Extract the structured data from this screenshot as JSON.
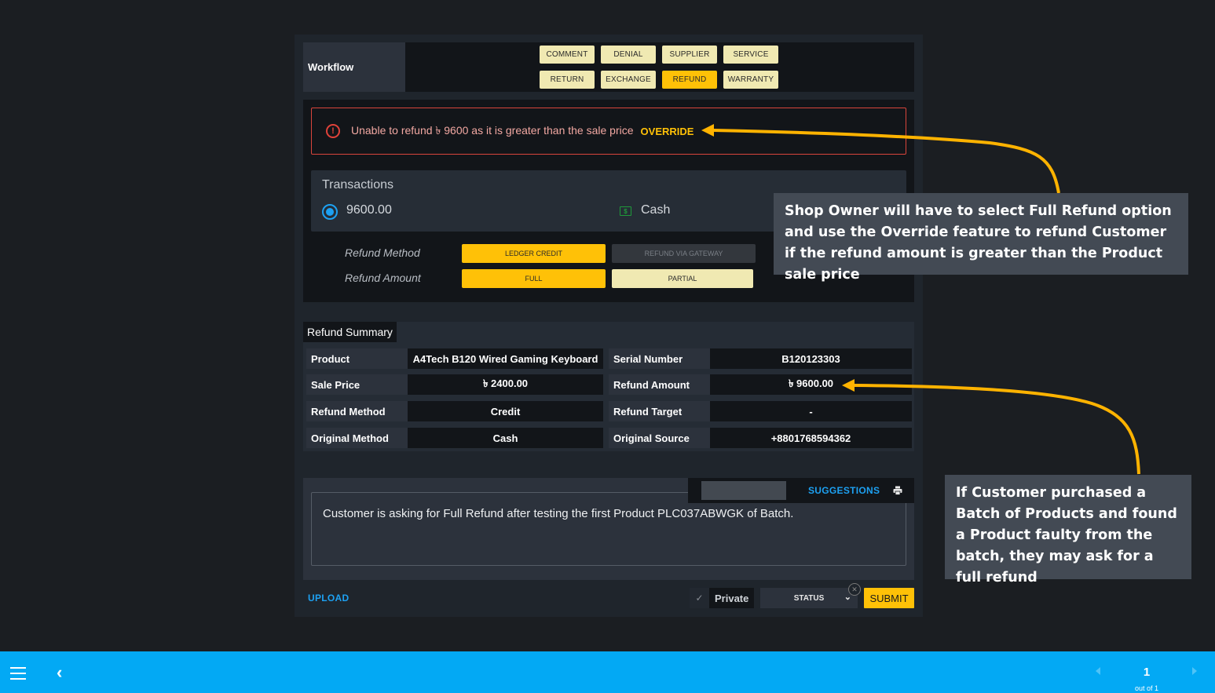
{
  "workflow": {
    "label": "Workflow",
    "buttons": [
      {
        "label": "COMMENT",
        "active": false
      },
      {
        "label": "DENIAL",
        "active": false
      },
      {
        "label": "SUPPLIER",
        "active": false
      },
      {
        "label": "SERVICE",
        "active": false
      },
      {
        "label": "RETURN",
        "active": false
      },
      {
        "label": "EXCHANGE",
        "active": false
      },
      {
        "label": "REFUND",
        "active": true
      },
      {
        "label": "WARRANTY",
        "active": false
      }
    ]
  },
  "alert": {
    "icon": "exclamation-circle-icon",
    "message": "Unable to refund ৳ 9600 as it is greater than the sale price",
    "action": "OVERRIDE"
  },
  "transactions": {
    "title": "Transactions",
    "amount": "9600.00",
    "selected": true,
    "method_icon": "cash-icon",
    "method": "Cash"
  },
  "refund_options": {
    "method_label": "Refund Method",
    "method_options": [
      "LEDGER CREDIT",
      "REFUND VIA GATEWAY"
    ],
    "method_selected": "LEDGER CREDIT",
    "amount_label": "Refund Amount",
    "amount_options": [
      "FULL",
      "PARTIAL"
    ],
    "amount_selected": "FULL"
  },
  "summary": {
    "title": "Refund Summary",
    "rows": [
      {
        "k1": "Product",
        "v1": "A4Tech B120 Wired Gaming Keyboard",
        "k2": "Serial Number",
        "v2": "B120123303"
      },
      {
        "k1": "Sale Price",
        "v1": "৳ 2400.00",
        "k2": "Refund Amount",
        "v2": "৳ 9600.00"
      },
      {
        "k1": "Refund Method",
        "v1": "Credit",
        "k2": "Refund Target",
        "v2": "-"
      },
      {
        "k1": "Original Method",
        "v1": "Cash",
        "k2": "Original Source",
        "v2": "+8801768594362"
      }
    ]
  },
  "notes": {
    "text": "Customer is asking for Full Refund after testing the first Product PLC037ABWGK of Batch.",
    "suggestions": "SUGGESTIONS",
    "upload": "UPLOAD",
    "private_label": "Private",
    "status_label": "STATUS",
    "submit": "SUBMIT"
  },
  "callouts": [
    "Shop Owner will have to select Full Refund option and use the Override feature to refund Customer if the refund amount is greater than the Product sale price",
    "If Customer purchased a Batch of Products and found a Product faulty from the batch, they may ask for a full refund"
  ],
  "colors": {
    "accent": "#ffc107",
    "link": "#1da1f2",
    "error": "#e0423a",
    "bottom_bar": "#03a9f4"
  },
  "pagination": {
    "page": "1",
    "total_text": "out of 1"
  }
}
